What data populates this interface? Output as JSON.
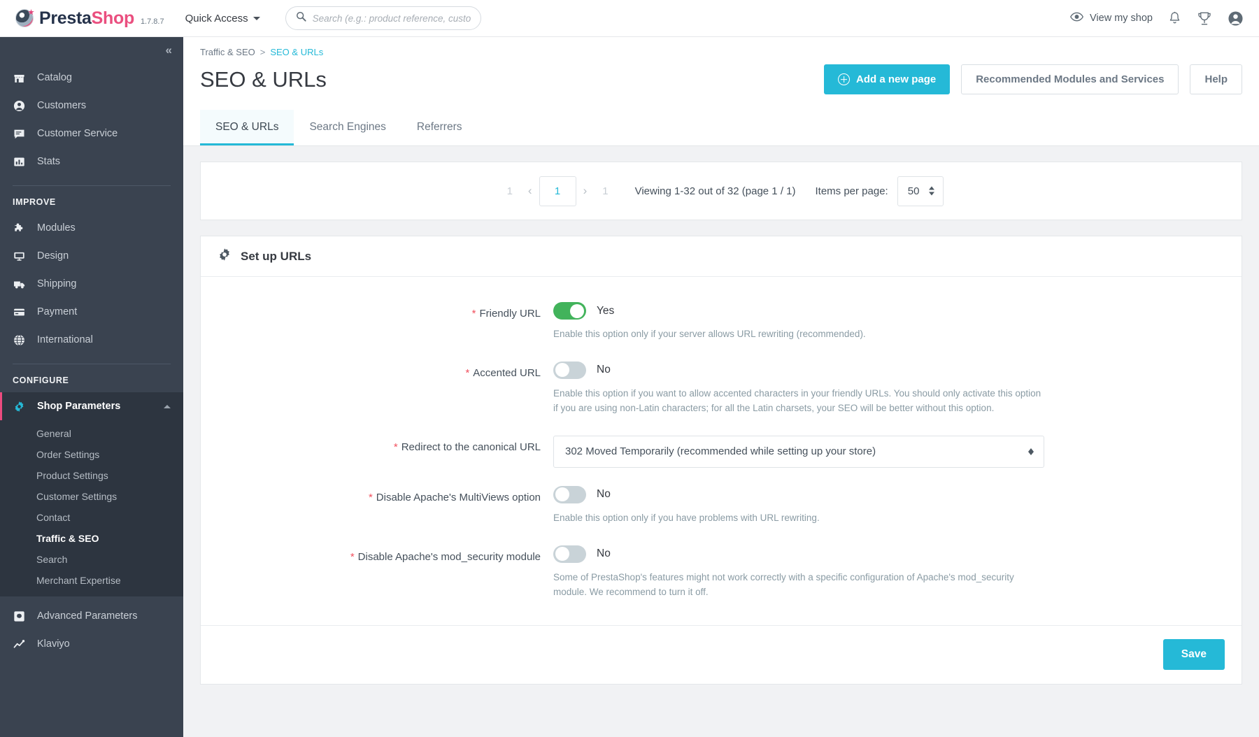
{
  "topbar": {
    "brand_presta": "Presta",
    "brand_shop": "Shop",
    "version": "1.7.8.7",
    "quick_access": "Quick Access",
    "search_placeholder": "Search (e.g.: product reference, custom",
    "search_value": "",
    "view_my_shop": "View my shop"
  },
  "sidebar": {
    "top_items": [
      {
        "label": "Catalog",
        "icon": "store-icon"
      },
      {
        "label": "Customers",
        "icon": "person-circle-icon"
      },
      {
        "label": "Customer Service",
        "icon": "chat-icon"
      },
      {
        "label": "Stats",
        "icon": "bar-chart-icon"
      }
    ],
    "improve_title": "IMPROVE",
    "improve_items": [
      {
        "label": "Modules",
        "icon": "puzzle-icon"
      },
      {
        "label": "Design",
        "icon": "monitor-icon"
      },
      {
        "label": "Shipping",
        "icon": "truck-icon"
      },
      {
        "label": "Payment",
        "icon": "credit-card-icon"
      },
      {
        "label": "International",
        "icon": "globe-icon"
      }
    ],
    "configure_title": "CONFIGURE",
    "shop_parameters": {
      "label": "Shop Parameters",
      "icon": "gear-icon"
    },
    "shop_parameters_sub": [
      "General",
      "Order Settings",
      "Product Settings",
      "Customer Settings",
      "Contact",
      "Traffic & SEO",
      "Search",
      "Merchant Expertise"
    ],
    "active_sub": "Traffic & SEO",
    "advanced_parameters": {
      "label": "Advanced Parameters",
      "icon": "cog-square-icon"
    },
    "klaviyo": {
      "label": "Klaviyo",
      "icon": "trend-icon"
    }
  },
  "page": {
    "breadcrumb_parent": "Traffic & SEO",
    "breadcrumb_sep": ">",
    "breadcrumb_current": "SEO & URLs",
    "title": "SEO & URLs",
    "add_page_button": "Add a new page",
    "recommended_button": "Recommended Modules and Services",
    "help_button": "Help"
  },
  "tabs": [
    {
      "label": "SEO & URLs",
      "active": true
    },
    {
      "label": "Search Engines",
      "active": false
    },
    {
      "label": "Referrers",
      "active": false
    }
  ],
  "pagination": {
    "first": "1",
    "prev": "‹",
    "current": "1",
    "next": "›",
    "last": "1",
    "viewing": "Viewing 1-32 out of 32 (page 1 / 1)",
    "items_per_page_label": "Items per page:",
    "items_per_page_value": "50"
  },
  "setup_panel": {
    "title": "Set up URLs",
    "icon": "gear-icon",
    "rows": [
      {
        "label": "Friendly URL",
        "required": true,
        "type": "switch",
        "state": "on",
        "state_text": "Yes",
        "help": "Enable this option only if your server allows URL rewriting (recommended)."
      },
      {
        "label": "Accented URL",
        "required": true,
        "type": "switch",
        "state": "off",
        "state_text": "No",
        "help": "Enable this option if you want to allow accented characters in your friendly URLs. You should only activate this option if you are using non-Latin characters; for all the Latin charsets, your SEO will be better without this option."
      },
      {
        "label": "Redirect to the canonical URL",
        "required": true,
        "type": "select",
        "value": "302 Moved Temporarily (recommended while setting up your store)",
        "help": ""
      },
      {
        "label": "Disable Apache's MultiViews option",
        "required": true,
        "type": "switch",
        "state": "off",
        "state_text": "No",
        "help": "Enable this option only if you have problems with URL rewriting."
      },
      {
        "label": "Disable Apache's mod_security module",
        "required": true,
        "type": "switch",
        "state": "off",
        "state_text": "No",
        "help": "Some of PrestaShop's features might not work correctly with a specific configuration of Apache's mod_security module. We recommend to turn it off."
      }
    ],
    "save_button": "Save"
  },
  "colors": {
    "accent": "#25b9d7",
    "brand_pink": "#ea4f7f",
    "sidebar_bg": "#3a4350",
    "switch_on": "#42b35b",
    "required_star": "#f1515f"
  }
}
